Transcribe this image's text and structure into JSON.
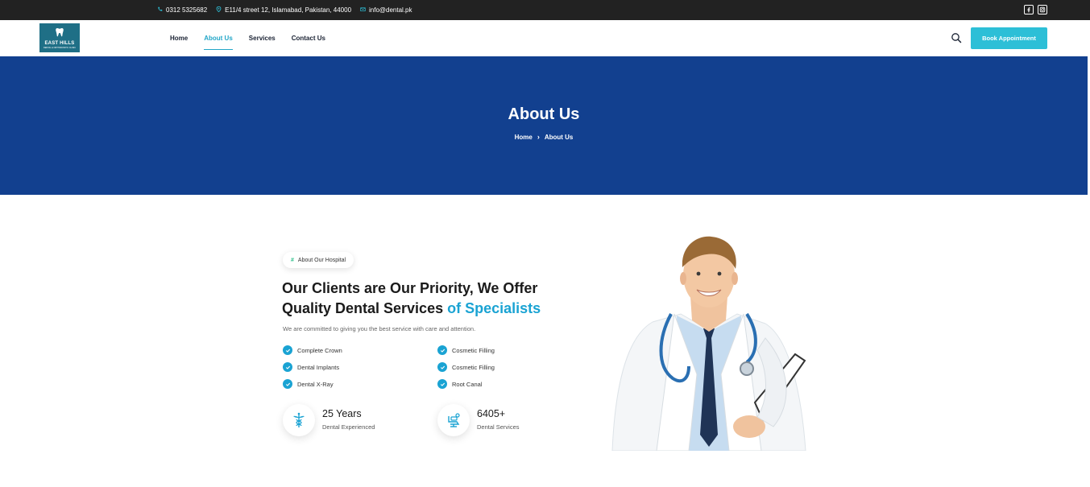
{
  "topbar": {
    "phone": "0312 5325682",
    "address": "E11/4 street 12, Islamabad, Pakistan, 44000",
    "email": "info@dental.pk",
    "social": [
      "facebook-icon",
      "instagram-icon"
    ]
  },
  "header": {
    "logo_title": "EAST HILLS",
    "logo_subtitle": "DENTAL & ORTHODONTIC CLINIC",
    "nav": [
      {
        "label": "Home"
      },
      {
        "label": "About Us"
      },
      {
        "label": "Services"
      },
      {
        "label": "Contact Us"
      }
    ],
    "active_nav": "About Us",
    "cta_label": "Book Appointment"
  },
  "banner": {
    "title": "About Us",
    "breadcrumb": [
      "Home",
      "About Us"
    ]
  },
  "about": {
    "tag": "About Our Hospital",
    "heading_part1": "Our Clients are Our Priority, We Offer Quality Dental Services ",
    "heading_highlight": "of Specialists",
    "subtext": "We are committed to giving you the best service with care and attention.",
    "features_left": [
      "Complete Crown",
      "Dental Implants",
      "Dental X-Ray"
    ],
    "features_right": [
      "Cosmetic Filling",
      "Cosmetic Filling",
      "Root Canal"
    ],
    "stats": [
      {
        "value": "25 Years",
        "label": "Dental Experienced",
        "icon": "caduceus-icon"
      },
      {
        "value": "6405+",
        "label": "Dental Services",
        "icon": "dental-chair-icon"
      }
    ]
  },
  "colors": {
    "topbar_bg": "#222222",
    "banner_bg": "#12408f",
    "accent": "#2dbfd7",
    "highlight": "#1aa3d3"
  }
}
